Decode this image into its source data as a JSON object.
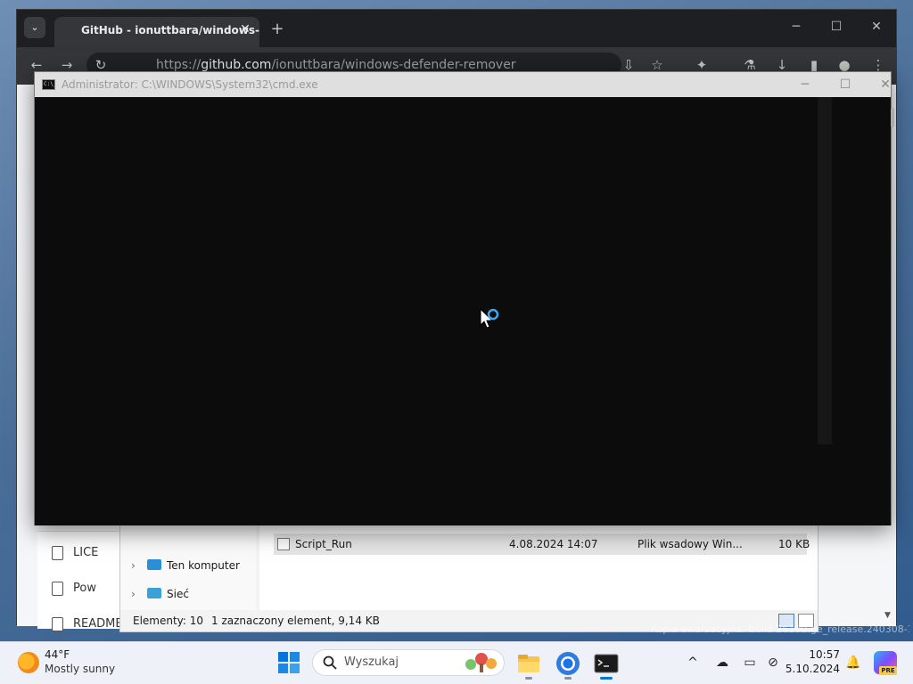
{
  "browser": {
    "tab_title": "GitHub - ionuttbara/windows-",
    "url_prefix": "https://",
    "url_domain": "github.com",
    "url_path": "/ionuttbara/windows-defender-remover",
    "tab_close": "✕",
    "new_tab": "+",
    "window_controls": {
      "minimize": "─",
      "maximize": "☐",
      "close": "✕"
    }
  },
  "cmd": {
    "title": "Administrator: C:\\WINDOWS\\System32\\cmd.exe",
    "icon_text": "C:\\_",
    "window_controls": {
      "minimize": "─",
      "maximize": "☐",
      "close": "✕"
    }
  },
  "explorer": {
    "nav_items": [
      {
        "label": "Ten komputer",
        "icon_color": "#2b8fd8"
      },
      {
        "label": "Sieć",
        "icon_color": "#3aa0d8"
      }
    ],
    "selected_row": {
      "name": "Script_Run",
      "date": "4.08.2024 14:07",
      "type": "Plik wsadowy Win...",
      "size": "10 KB"
    },
    "status": {
      "items": "Elementy: 10",
      "selected": "1 zaznaczony element, 9,14 KB"
    }
  },
  "filelist": {
    "items": [
      "LICE",
      "Pow",
      "README"
    ]
  },
  "watermark": "Kopia ewaluacyjna. Build 26100.ge_release.240308-1400",
  "taskbar": {
    "weather_temp": "44°F",
    "weather_desc": "Mostly sunny",
    "search_placeholder": "Wyszukaj",
    "time": "10:57",
    "date": "5.10.2024",
    "copilot_badge": "PRE"
  },
  "colors": {
    "accent": "#0078d4",
    "cmd_background": "#0c0c0c",
    "taskbar": "#eef1f7"
  }
}
